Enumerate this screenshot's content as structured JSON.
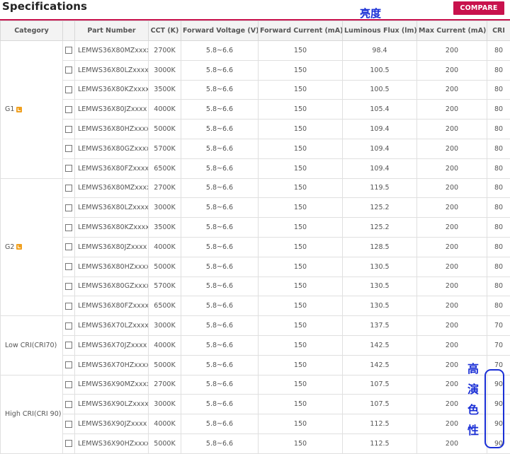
{
  "page": {
    "title": "Specifications",
    "compare_label": "COMPARE",
    "annotation_top": "亮度",
    "annotation_side": [
      "高",
      "演",
      "色",
      "性"
    ]
  },
  "colors": {
    "accent": "#c8124d",
    "annotation": "#1a2fd6",
    "badge": "#f0a020"
  },
  "table": {
    "headers": {
      "category": "Category",
      "part": "Part Number",
      "cct": "CCT (K)",
      "voltage": "Forward Voltage (V)",
      "current": "Forward Current (mA)",
      "flux": "Luminous Flux (lm)",
      "max_current": "Max Current (mA)",
      "cri": "CRI"
    },
    "groups": [
      {
        "category": "G1",
        "badge_icon": "check-badge-icon",
        "rows": [
          {
            "part": "LEMWS36X80MZxxxx",
            "cct": "2700K",
            "voltage": "5.8~6.6",
            "current": "150",
            "flux": "98.4",
            "max_current": "200",
            "cri": "80"
          },
          {
            "part": "LEMWS36X80LZxxxx",
            "cct": "3000K",
            "voltage": "5.8~6.6",
            "current": "150",
            "flux": "100.5",
            "max_current": "200",
            "cri": "80"
          },
          {
            "part": "LEMWS36X80KZxxxx",
            "cct": "3500K",
            "voltage": "5.8~6.6",
            "current": "150",
            "flux": "100.5",
            "max_current": "200",
            "cri": "80"
          },
          {
            "part": "LEMWS36X80JZxxxx",
            "cct": "4000K",
            "voltage": "5.8~6.6",
            "current": "150",
            "flux": "105.4",
            "max_current": "200",
            "cri": "80"
          },
          {
            "part": "LEMWS36X80HZxxxx",
            "cct": "5000K",
            "voltage": "5.8~6.6",
            "current": "150",
            "flux": "109.4",
            "max_current": "200",
            "cri": "80"
          },
          {
            "part": "LEMWS36X80GZxxxx",
            "cct": "5700K",
            "voltage": "5.8~6.6",
            "current": "150",
            "flux": "109.4",
            "max_current": "200",
            "cri": "80"
          },
          {
            "part": "LEMWS36X80FZxxxx",
            "cct": "6500K",
            "voltage": "5.8~6.6",
            "current": "150",
            "flux": "109.4",
            "max_current": "200",
            "cri": "80"
          }
        ]
      },
      {
        "category": "G2",
        "badge_icon": "check-badge-icon",
        "rows": [
          {
            "part": "LEMWS36X80MZxxxx",
            "cct": "2700K",
            "voltage": "5.8~6.6",
            "current": "150",
            "flux": "119.5",
            "max_current": "200",
            "cri": "80"
          },
          {
            "part": "LEMWS36X80LZxxxx",
            "cct": "3000K",
            "voltage": "5.8~6.6",
            "current": "150",
            "flux": "125.2",
            "max_current": "200",
            "cri": "80"
          },
          {
            "part": "LEMWS36X80KZxxxx",
            "cct": "3500K",
            "voltage": "5.8~6.6",
            "current": "150",
            "flux": "125.2",
            "max_current": "200",
            "cri": "80"
          },
          {
            "part": "LEMWS36X80JZxxxx",
            "cct": "4000K",
            "voltage": "5.8~6.6",
            "current": "150",
            "flux": "128.5",
            "max_current": "200",
            "cri": "80"
          },
          {
            "part": "LEMWS36X80HZxxxx",
            "cct": "5000K",
            "voltage": "5.8~6.6",
            "current": "150",
            "flux": "130.5",
            "max_current": "200",
            "cri": "80"
          },
          {
            "part": "LEMWS36X80GZxxxx",
            "cct": "5700K",
            "voltage": "5.8~6.6",
            "current": "150",
            "flux": "130.5",
            "max_current": "200",
            "cri": "80"
          },
          {
            "part": "LEMWS36X80FZxxxx",
            "cct": "6500K",
            "voltage": "5.8~6.6",
            "current": "150",
            "flux": "130.5",
            "max_current": "200",
            "cri": "80"
          }
        ]
      },
      {
        "category": "Low CRI(CRI70)",
        "badge_icon": "",
        "rows": [
          {
            "part": "LEMWS36X70LZxxxx",
            "cct": "3000K",
            "voltage": "5.8~6.6",
            "current": "150",
            "flux": "137.5",
            "max_current": "200",
            "cri": "70"
          },
          {
            "part": "LEMWS36X70JZxxxx",
            "cct": "4000K",
            "voltage": "5.8~6.6",
            "current": "150",
            "flux": "142.5",
            "max_current": "200",
            "cri": "70"
          },
          {
            "part": "LEMWS36X70HZxxxx",
            "cct": "5000K",
            "voltage": "5.8~6.6",
            "current": "150",
            "flux": "142.5",
            "max_current": "200",
            "cri": "70"
          }
        ]
      },
      {
        "category": "High CRI(CRI 90)",
        "badge_icon": "",
        "rows": [
          {
            "part": "LEMWS36X90MZxxxx",
            "cct": "2700K",
            "voltage": "5.8~6.6",
            "current": "150",
            "flux": "107.5",
            "max_current": "200",
            "cri": "90"
          },
          {
            "part": "LEMWS36X90LZxxxx",
            "cct": "3000K",
            "voltage": "5.8~6.6",
            "current": "150",
            "flux": "107.5",
            "max_current": "200",
            "cri": "90"
          },
          {
            "part": "LEMWS36X90JZxxxx",
            "cct": "4000K",
            "voltage": "5.8~6.6",
            "current": "150",
            "flux": "112.5",
            "max_current": "200",
            "cri": "90"
          },
          {
            "part": "LEMWS36X90HZxxxx",
            "cct": "5000K",
            "voltage": "5.8~6.6",
            "current": "150",
            "flux": "112.5",
            "max_current": "200",
            "cri": "90"
          }
        ]
      }
    ]
  }
}
